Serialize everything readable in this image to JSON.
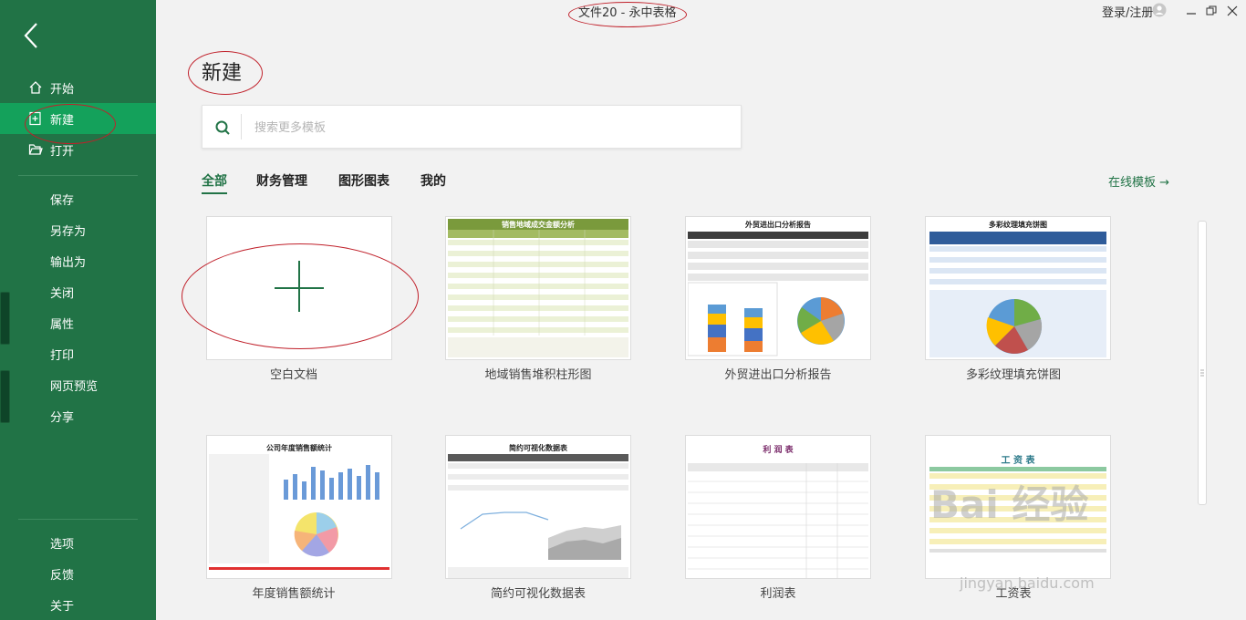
{
  "window": {
    "title": "文件20 - 永中表格",
    "login": "登录/注册"
  },
  "sidebar": {
    "nav": [
      {
        "label": "开始",
        "icon": "home-icon"
      },
      {
        "label": "新建",
        "icon": "new-file-icon",
        "active": true
      },
      {
        "label": "打开",
        "icon": "folder-open-icon"
      }
    ],
    "menu": [
      "保存",
      "另存为",
      "输出为",
      "关闭",
      "属性",
      "打印",
      "网页预览",
      "分享"
    ],
    "footer": [
      "选项",
      "反馈",
      "关于"
    ]
  },
  "main": {
    "title": "新建",
    "search_placeholder": "搜索更多模板",
    "tabs": [
      "全部",
      "财务管理",
      "图形图表",
      "我的"
    ],
    "online_link": "在线模板 →",
    "templates": [
      {
        "label": "空白文档"
      },
      {
        "label": "地域销售堆积柱形图",
        "thumb_title": "销售地域成交金额分析"
      },
      {
        "label": "外贸进出口分析报告",
        "thumb_title": "外贸进出口分析报告"
      },
      {
        "label": "多彩纹理填充饼图",
        "thumb_title": "多彩纹理填充饼图"
      },
      {
        "label": "年度销售额统计",
        "thumb_title": "公司年度销售额统计"
      },
      {
        "label": "简约可视化数据表",
        "thumb_title": "简约可视化数据表"
      },
      {
        "label": "利润表",
        "thumb_title": "利 润 表"
      },
      {
        "label": "工资表",
        "thumb_title": "工 资 表"
      }
    ]
  },
  "colors": {
    "accent": "#217346",
    "sidebar_active": "#14a15b",
    "annotation": "#c0202a"
  },
  "watermark": {
    "brand": "Bai 经验",
    "url": "jingyan.baidu.com"
  }
}
